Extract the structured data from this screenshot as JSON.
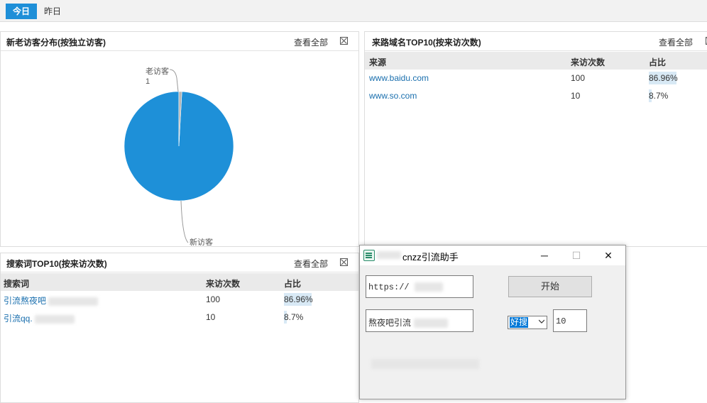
{
  "tabs": [
    {
      "label": "今日",
      "active": true
    },
    {
      "label": "昨日",
      "active": false
    }
  ],
  "visitor_panel": {
    "title": "新老访客分布(按独立访客)",
    "view_all": "查看全部",
    "chart_data": {
      "type": "pie",
      "slices": [
        {
          "label": "新访客",
          "value": 114,
          "color": "#1e90d8"
        },
        {
          "label": "老访客",
          "value": 1,
          "color": "#b5b5b5"
        }
      ]
    },
    "old_label": "老访客",
    "old_value": "1",
    "new_label": "新访客",
    "new_value": "114"
  },
  "source_panel": {
    "title": "来路域名TOP10(按来访次数)",
    "view_all": "查看全部",
    "headers": [
      "来源",
      "来访次数",
      "占比"
    ],
    "rows": [
      {
        "source": "www.baidu.com",
        "visits": "100",
        "pct": "86.96%",
        "pct_value": 0.8696
      },
      {
        "source": "www.so.com",
        "visits": "10",
        "pct": "8.7%",
        "pct_value": 0.087
      }
    ]
  },
  "keyword_panel": {
    "title": "搜索词TOP10(按来访次数)",
    "view_all": "查看全部",
    "headers": [
      "搜索词",
      "来访次数",
      "占比"
    ],
    "rows": [
      {
        "keyword": "引流熬夜吧",
        "visits": "100",
        "pct": "86.96%",
        "pct_value": 0.8696
      },
      {
        "keyword": "引流qq.",
        "visits": "10",
        "pct": "8.7%",
        "pct_value": 0.087
      }
    ]
  },
  "dialog": {
    "title": "cnzz引流助手",
    "url_field": "https://",
    "start_button": "开始",
    "keyword_field": "熬夜吧引流",
    "engine_select": "好搜",
    "count_field": "10",
    "minimize": "─",
    "maximize": "☐",
    "close": "✕"
  },
  "colors": {
    "accent": "#1e90d8",
    "link": "#1a6fae",
    "pct_bar": "#d8e9f5"
  }
}
